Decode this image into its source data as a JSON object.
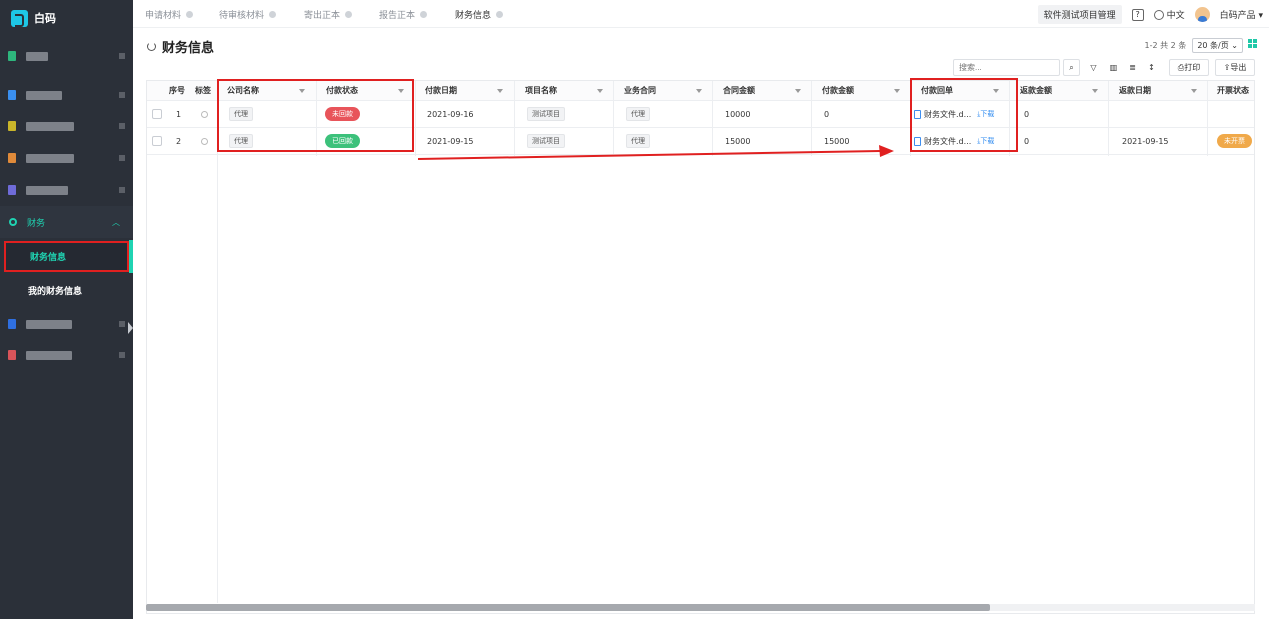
{
  "app": {
    "logo_text": "白码"
  },
  "tabs": [
    {
      "label": "申请材料"
    },
    {
      "label": "待审核材料"
    },
    {
      "label": "寄出正本"
    },
    {
      "label": "报告正本"
    },
    {
      "label": "财务信息"
    }
  ],
  "topbar": {
    "project": "软件测试项目管理",
    "language": "中文",
    "product": "白码产品"
  },
  "sidebar": {
    "finance_group": "财务",
    "items": [
      {
        "label": "财务信息"
      },
      {
        "label": "我的财务信息"
      }
    ]
  },
  "page": {
    "title": "财务信息"
  },
  "pager": {
    "summary": "1-2 共 2 条",
    "page_size": "20 条/页"
  },
  "toolbar": {
    "search_placeholder": "搜索...",
    "print": "打印",
    "export": "导出"
  },
  "table": {
    "headers": {
      "index": "序号",
      "tag": "标签",
      "company": "公司名称",
      "pay_status": "付款状态",
      "pay_date": "付款日期",
      "project": "项目名称",
      "contract": "业务合同",
      "contract_amount": "合同金额",
      "pay_amount": "付款金额",
      "receipt": "付款回单",
      "refund_amount": "返款金额",
      "refund_date": "返款日期",
      "invoice_status": "开票状态"
    },
    "rows": [
      {
        "index": "1",
        "company": "代理",
        "pay_status": "未回款",
        "pay_status_color": "#e8545a",
        "pay_date": "2021-09-16",
        "project": "测试项目",
        "contract": "代理",
        "contract_amount": "10000",
        "pay_amount": "0",
        "receipt": "财务文件.d...",
        "download": "下载",
        "refund_amount": "0",
        "refund_date": "",
        "invoice_status": "",
        "invoice_color": ""
      },
      {
        "index": "2",
        "company": "代理",
        "pay_status": "已回款",
        "pay_status_color": "#3cc17b",
        "pay_date": "2021-09-15",
        "project": "测试项目",
        "contract": "代理",
        "contract_amount": "15000",
        "pay_amount": "15000",
        "receipt": "财务文件.d...",
        "download": "下载",
        "refund_amount": "0",
        "refund_date": "2021-09-15",
        "invoice_status": "未开票",
        "invoice_color": "#f0a94a"
      }
    ]
  }
}
